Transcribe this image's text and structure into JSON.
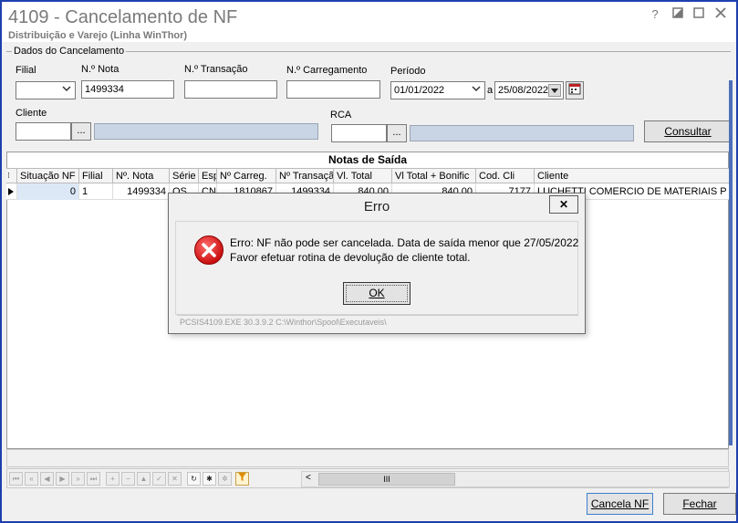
{
  "window": {
    "title": "4109 - Cancelamento de NF",
    "subtitle": "Distribuição e Varejo (Linha WinThor)",
    "help_glyph": "?"
  },
  "dados": {
    "legend": "Dados do Cancelamento",
    "filial_label": "Filial",
    "filial_value": "",
    "nota_label": "N.º Nota",
    "nota_value": "1499334",
    "transacao_label": "N.º Transação",
    "transacao_value": "",
    "carregamento_label": "N.º Carregamento",
    "carregamento_value": "",
    "periodo_label": "Período",
    "periodo_inicio": "01/01/2022",
    "periodo_sep": "a",
    "periodo_fim": "25/08/2022",
    "cliente_label": "Cliente",
    "rca_label": "RCA",
    "ellipsis": "...",
    "consultar_label": "Consultar"
  },
  "grid": {
    "caption": "Notas de Saída",
    "columns": [
      "Situação NF",
      "Filial",
      "Nº. Nota",
      "Série",
      "Esp",
      "Nº Carreg.",
      "Nº Transação",
      "Vl. Total",
      "Vl Total + Bonific",
      "Cod. Cli",
      "Cliente"
    ],
    "row": [
      "0",
      "1",
      "1499334",
      "OS",
      "CN",
      "1810867",
      "1499334",
      "840,00",
      "840,00",
      "7177",
      "LUCHETTI COMERCIO DE MATERIAIS P CON"
    ]
  },
  "footer": {
    "cancela_label": "Cancela NF",
    "fechar_label": "Fechar"
  },
  "dialog": {
    "title": "Erro",
    "close_glyph": "✕",
    "message_line1": "Erro: NF não pode ser cancelada. Data de saída menor que 27/05/2022",
    "message_line2": "Favor efetuar rotina de devolução de cliente total.",
    "ok_label": "OK",
    "status": "PCSIS4109.EXE 30.3.9.2 C:\\Winthor\\Spool\\Executaveis\\"
  }
}
